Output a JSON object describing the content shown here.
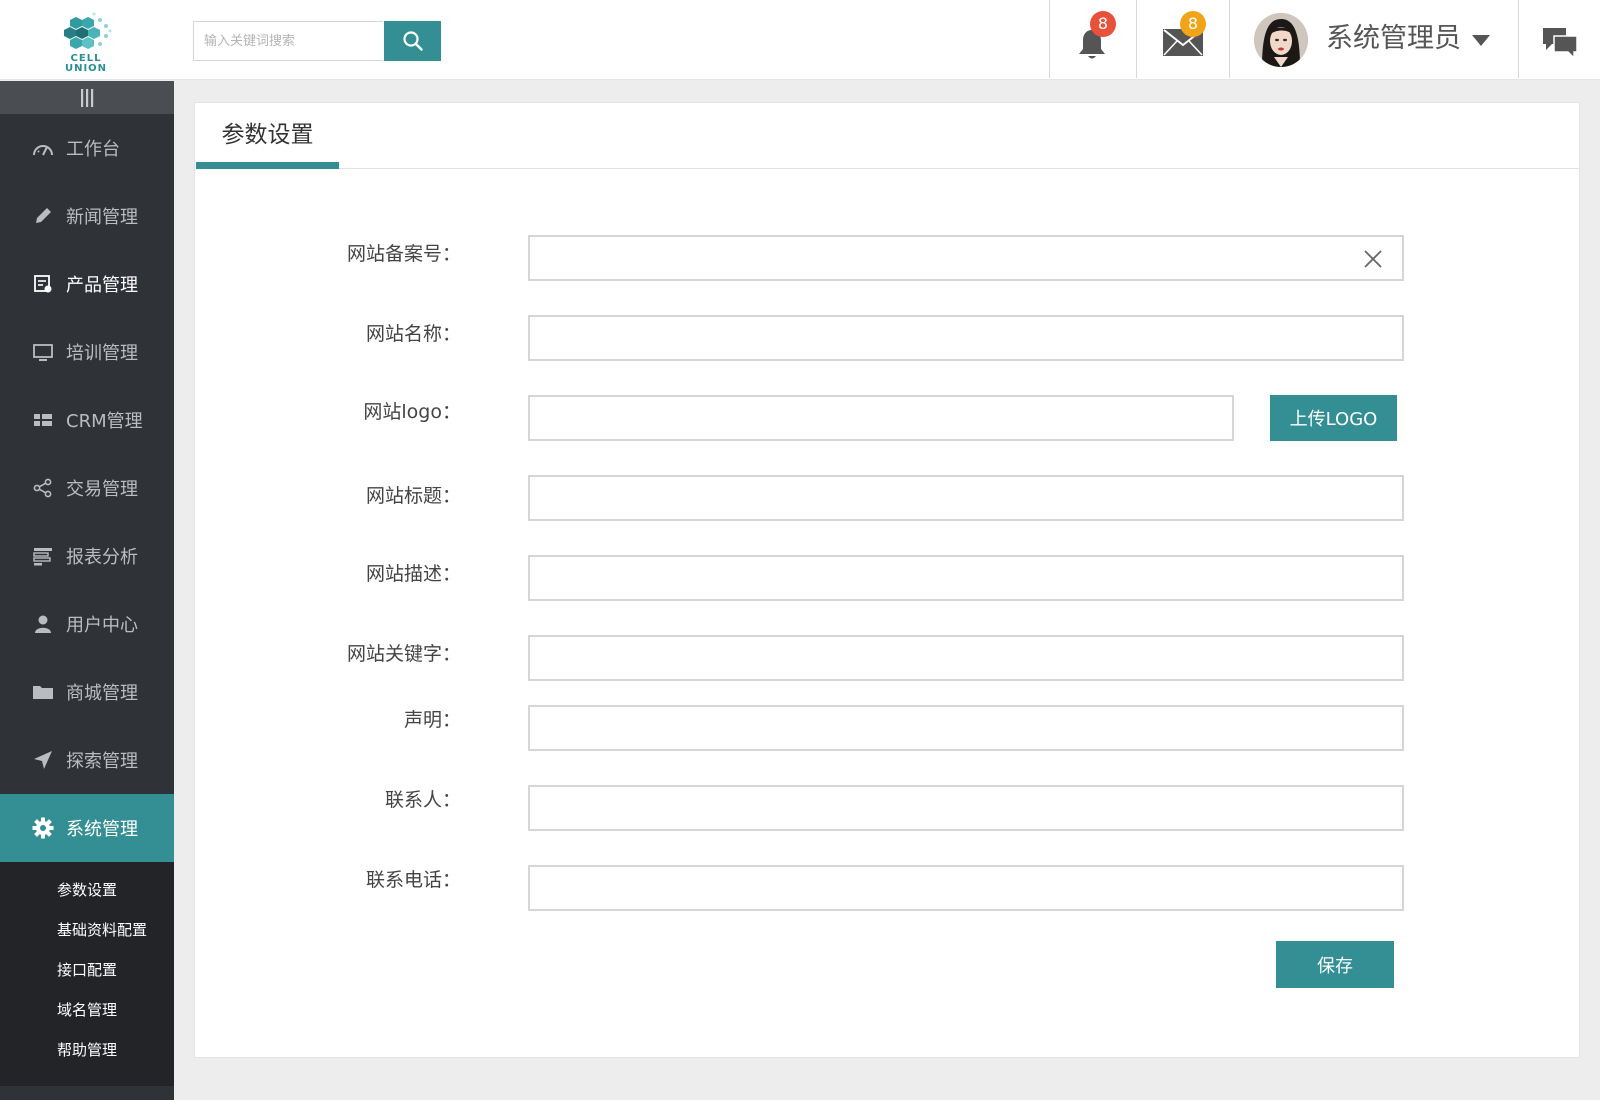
{
  "brand": {
    "logo_line1": "CELL",
    "logo_line2": "UNION"
  },
  "header": {
    "search_placeholder": "输入关键词搜索",
    "notifications_count": "8",
    "messages_count": "8",
    "username": "系统管理员"
  },
  "sidebar": {
    "items": [
      {
        "label": "工作台",
        "icon": "gauge-icon"
      },
      {
        "label": "新闻管理",
        "icon": "pencil-icon"
      },
      {
        "label": "产品管理",
        "icon": "product-list-icon"
      },
      {
        "label": "培训管理",
        "icon": "monitor-icon"
      },
      {
        "label": "CRM管理",
        "icon": "grid-icon"
      },
      {
        "label": "交易管理",
        "icon": "share-icon"
      },
      {
        "label": "报表分析",
        "icon": "report-icon"
      },
      {
        "label": "用户中心",
        "icon": "user-icon"
      },
      {
        "label": "商城管理",
        "icon": "folder-icon"
      },
      {
        "label": "探索管理",
        "icon": "navigation-icon"
      },
      {
        "label": "系统管理",
        "icon": "gear-icon"
      }
    ],
    "submenu": [
      "参数设置",
      "基础资料配置",
      "接口配置",
      "域名管理",
      "帮助管理"
    ]
  },
  "page": {
    "tab_title": "参数设置",
    "fields": {
      "icp": {
        "label": "网站备案号：",
        "value": ""
      },
      "site_name": {
        "label": "网站名称：",
        "value": ""
      },
      "site_logo": {
        "label": "网站logo：",
        "value": ""
      },
      "site_title": {
        "label": "网站标题：",
        "value": ""
      },
      "site_description": {
        "label": "网站描述：",
        "value": ""
      },
      "site_keywords": {
        "label": "网站关键字：",
        "value": ""
      },
      "statement": {
        "label": "声明：",
        "value": ""
      },
      "contact_person": {
        "label": "联系人：",
        "value": ""
      },
      "contact_phone": {
        "label": "联系电话：",
        "value": ""
      }
    },
    "upload_logo_label": "上传LOGO",
    "save_label": "保存"
  },
  "colors": {
    "accent": "#338f94",
    "sidebar_bg": "#2f3237",
    "badge_red": "#e8513a",
    "badge_orange": "#f3a318"
  }
}
